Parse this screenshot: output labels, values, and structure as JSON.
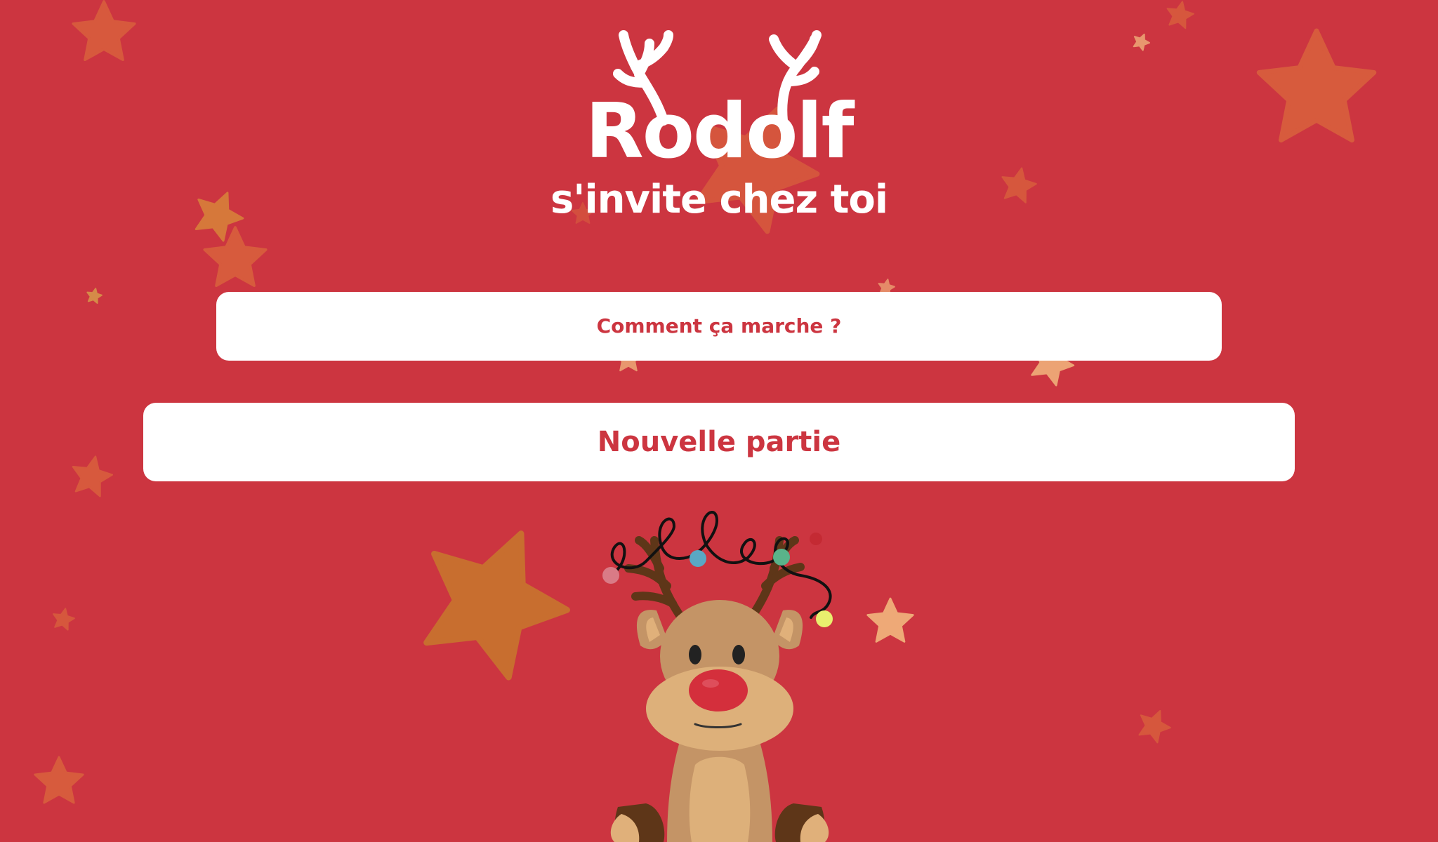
{
  "app": {
    "title": "Rodolf",
    "subtitle": "s'invite chez toi"
  },
  "menu": {
    "how_it_works_label": "Comment ça marche ?",
    "new_game_label": "Nouvelle partie"
  },
  "colors": {
    "background": "#cc3540",
    "button_background": "#ffffff",
    "button_text": "#cc3540",
    "star_orange": "#d9603d",
    "star_dark_orange": "#c8722f",
    "star_light": "#f0b07a"
  },
  "icons": {
    "logo_antlers": "antlers-icon",
    "mascot": "reindeer-illustration",
    "background_decoration": "star-icon"
  }
}
